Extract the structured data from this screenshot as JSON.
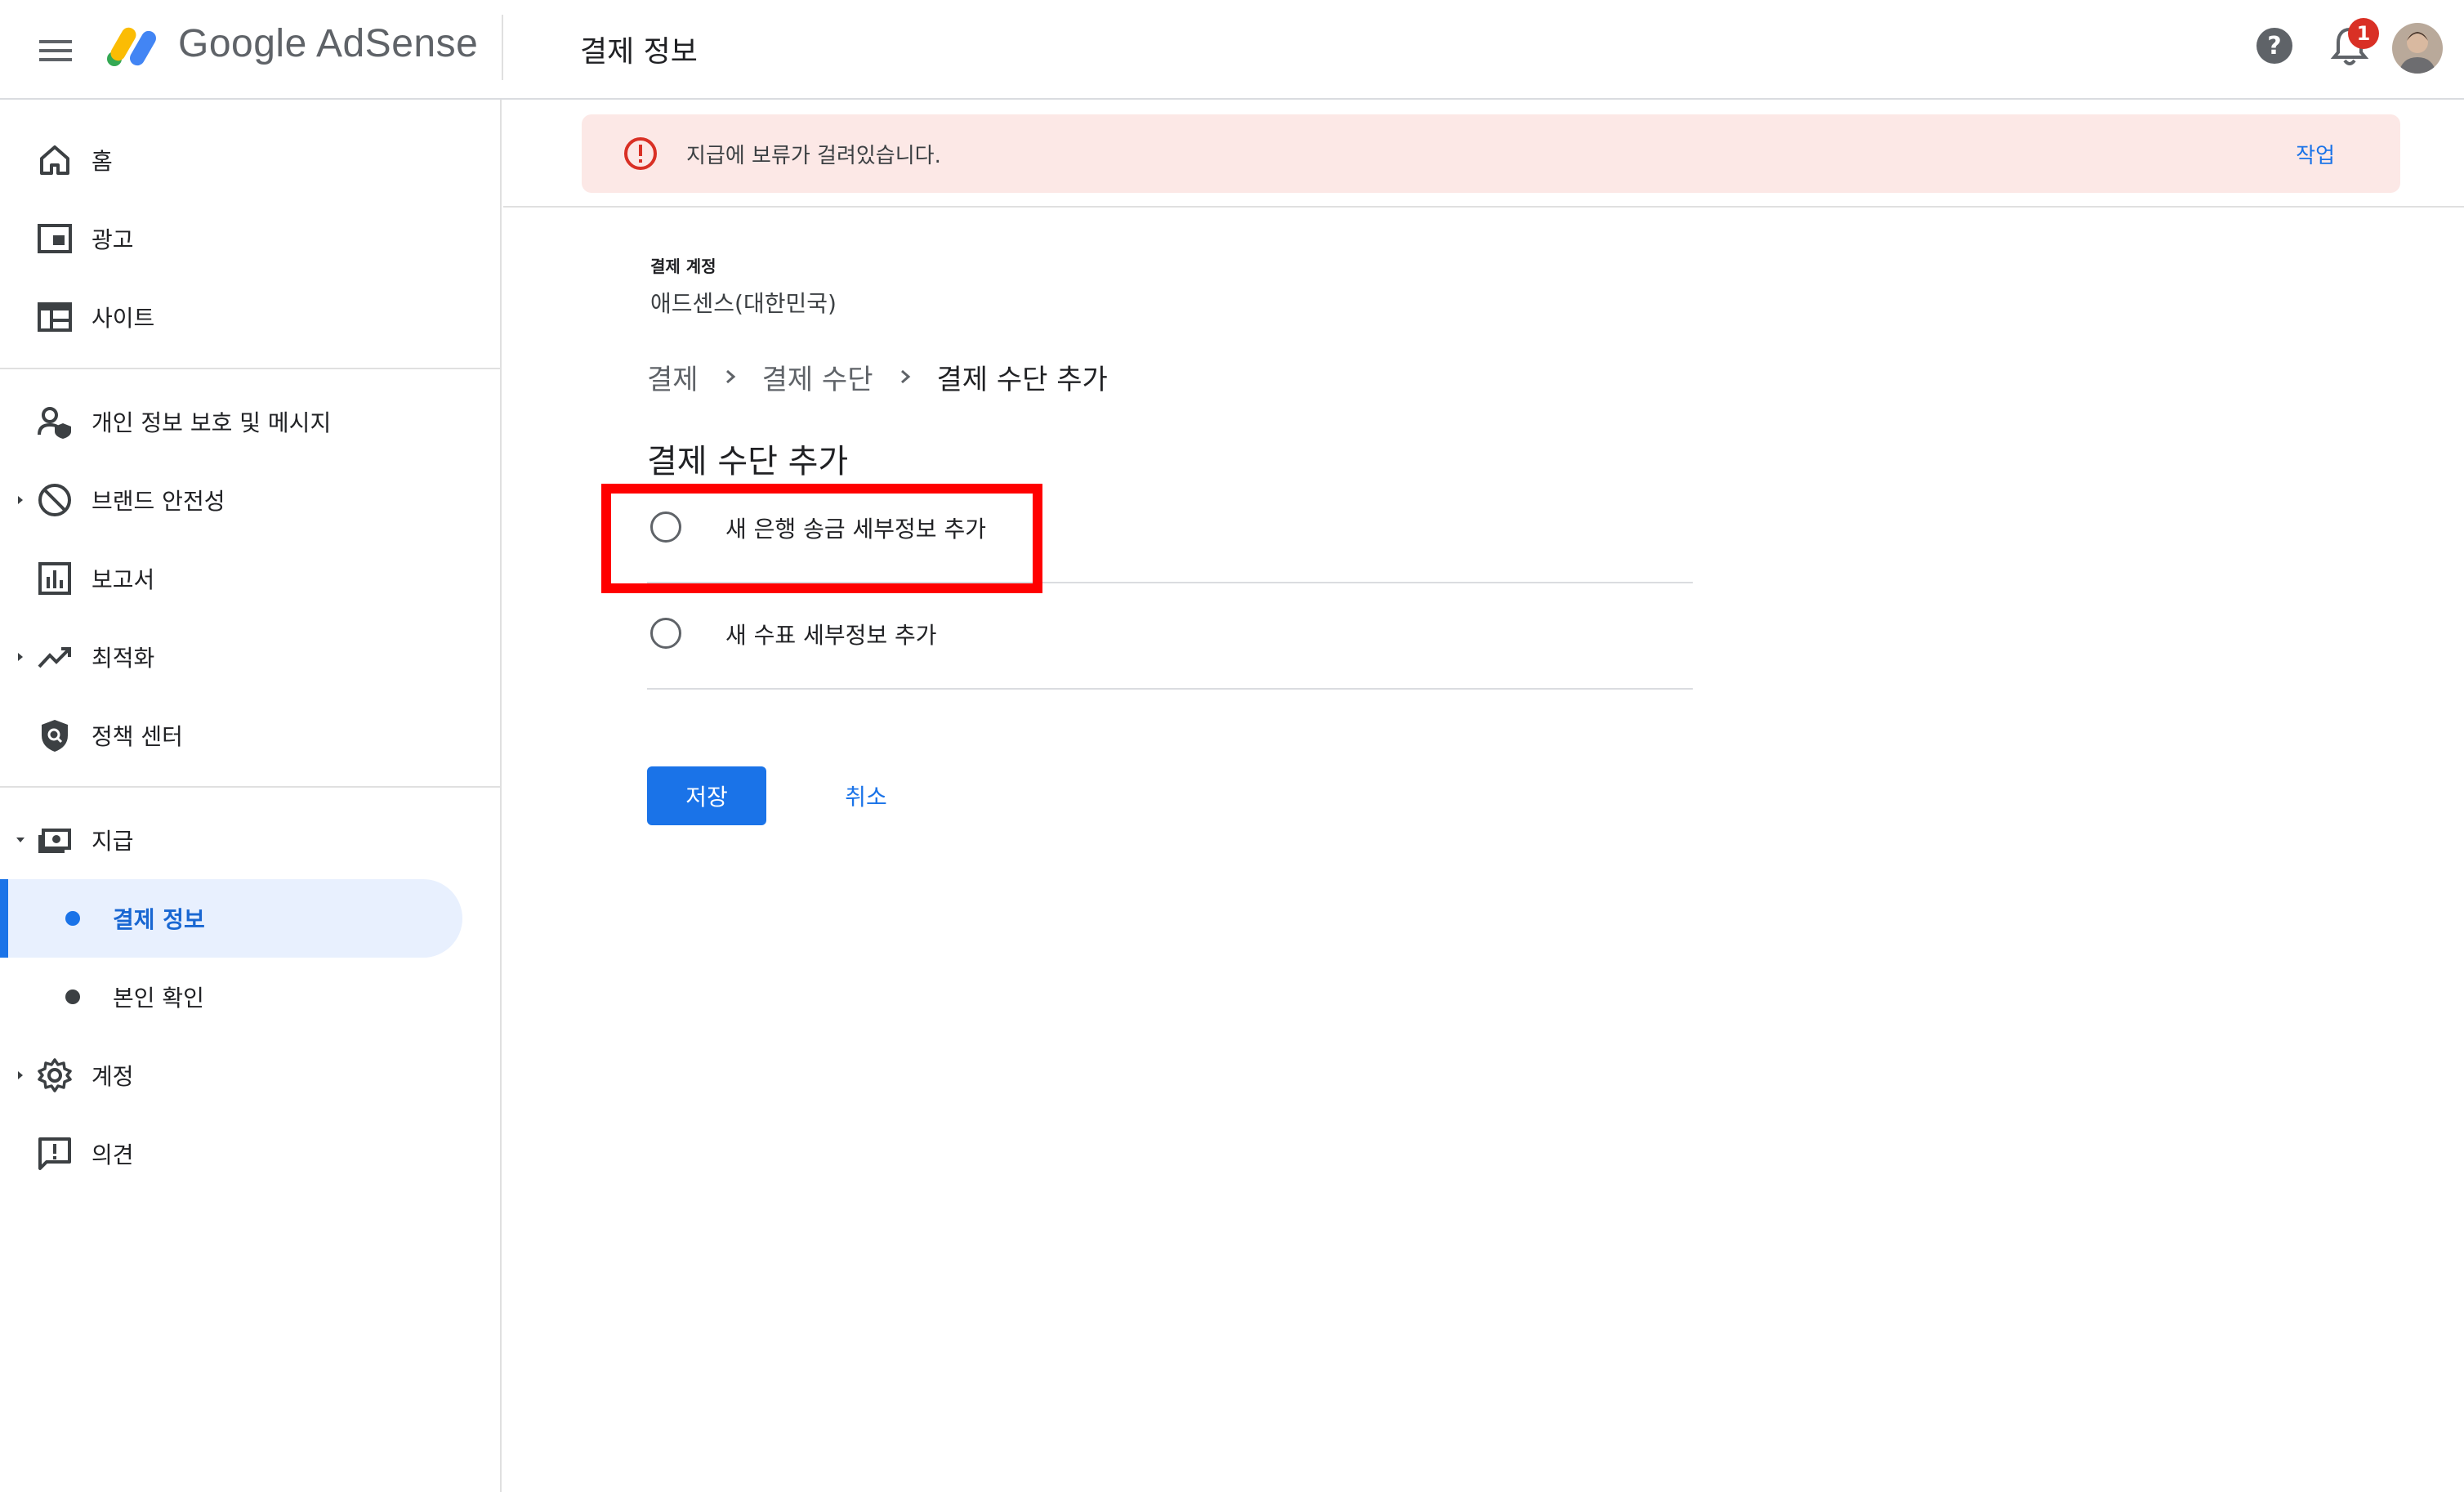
{
  "header": {
    "brand": "Google AdSense",
    "page_title": "결제 정보",
    "notification_count": "1",
    "icons": {
      "menu": "hamburger-menu-icon",
      "help": "help-circle-icon",
      "notifications": "bell-icon",
      "avatar": "user-avatar"
    }
  },
  "sidebar": {
    "items": [
      {
        "label": "홈",
        "icon": "home-icon"
      },
      {
        "label": "광고",
        "icon": "ads-icon"
      },
      {
        "label": "사이트",
        "icon": "sites-icon"
      },
      {
        "label": "개인 정보 보호 및 메시지",
        "icon": "privacy-messaging-icon"
      },
      {
        "label": "브랜드 안전성",
        "icon": "block-icon"
      },
      {
        "label": "보고서",
        "icon": "bar-chart-icon"
      },
      {
        "label": "최적화",
        "icon": "trending-up-icon"
      },
      {
        "label": "정책 센터",
        "icon": "policy-shield-icon"
      },
      {
        "label": "지급",
        "icon": "payments-icon"
      },
      {
        "label": "계정",
        "icon": "gear-icon"
      },
      {
        "label": "의견",
        "icon": "feedback-icon"
      }
    ],
    "sub_items": [
      {
        "label": "결제 정보",
        "active": true
      },
      {
        "label": "본인 확인",
        "active": false
      }
    ]
  },
  "alert": {
    "message": "지급에 보류가 걸려있습니다.",
    "action": "작업",
    "color": "#fce8e6"
  },
  "account": {
    "label": "결제 계정",
    "value": "애드센스(대한민국)"
  },
  "breadcrumb": [
    "결제",
    "결제 수단",
    "결제 수단 추가"
  ],
  "section_title": "결제 수단 추가",
  "options": [
    {
      "label": "새 은행 송금 세부정보 추가",
      "selected": false
    },
    {
      "label": "새 수표 세부정보 추가",
      "selected": false
    }
  ],
  "buttons": {
    "save": "저장",
    "cancel": "취소"
  },
  "colors": {
    "accent": "#1a73e8",
    "highlight_box": "#ff0000",
    "badge": "#d93025"
  }
}
